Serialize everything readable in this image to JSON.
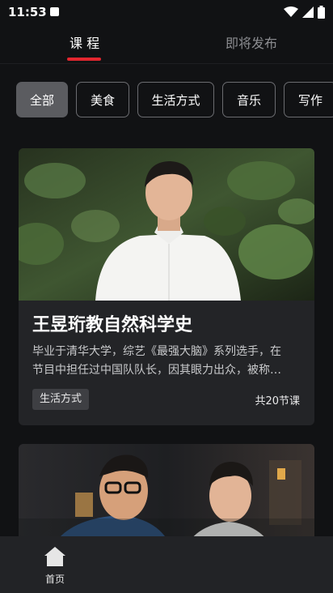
{
  "status": {
    "time": "11:53"
  },
  "tabs": [
    {
      "label": "课 程",
      "active": true
    },
    {
      "label": "即将发布",
      "active": false
    }
  ],
  "categories": [
    "全部",
    "美食",
    "生活方式",
    "音乐",
    "写作"
  ],
  "courses": [
    {
      "title": "王昱珩教自然科学史",
      "desc_line1": "毕业于清华大学，综艺《最强大脑》系列选手，在",
      "desc_line2": "节目中担任过中国队队长，因其眼力出众，被称…",
      "tag": "生活方式",
      "count": "共20节课"
    },
    {
      "title": "",
      "desc_line1": "",
      "desc_line2": "",
      "tag": "",
      "count": ""
    }
  ],
  "nav": {
    "home_label": "首页"
  },
  "colors": {
    "accent": "#e3262f",
    "background": "#111214",
    "card": "#232427"
  }
}
